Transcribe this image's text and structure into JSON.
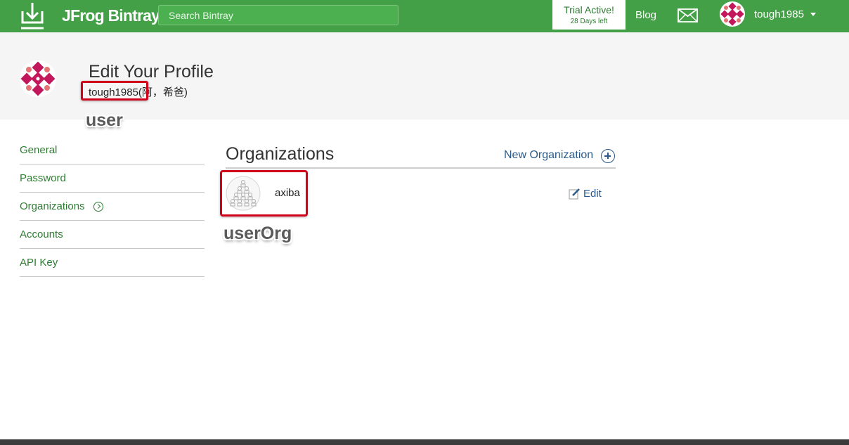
{
  "topbar": {
    "brand": "JFrog Bintray",
    "search_placeholder": "Search Bintray",
    "trial_title": "Trial Active!",
    "trial_sub": "28 Days left",
    "blog": "Blog",
    "username": "tough1985"
  },
  "profile": {
    "title": "Edit Your Profile",
    "username": "tough1985",
    "display_name": "(阿，希爸)"
  },
  "annotations": {
    "user": "user",
    "userOrg": "userOrg"
  },
  "sidebar": {
    "items": [
      {
        "label": "General"
      },
      {
        "label": "Password"
      },
      {
        "label": "Organizations"
      },
      {
        "label": "Accounts"
      },
      {
        "label": "API Key"
      }
    ]
  },
  "main": {
    "title": "Organizations",
    "new_org": "New Organization",
    "orgs": [
      {
        "name": "axiba",
        "edit": "Edit"
      }
    ]
  },
  "colors": {
    "brand_green": "#43a047",
    "link_blue": "#2b5a8a",
    "highlight_red": "#d0021b"
  }
}
